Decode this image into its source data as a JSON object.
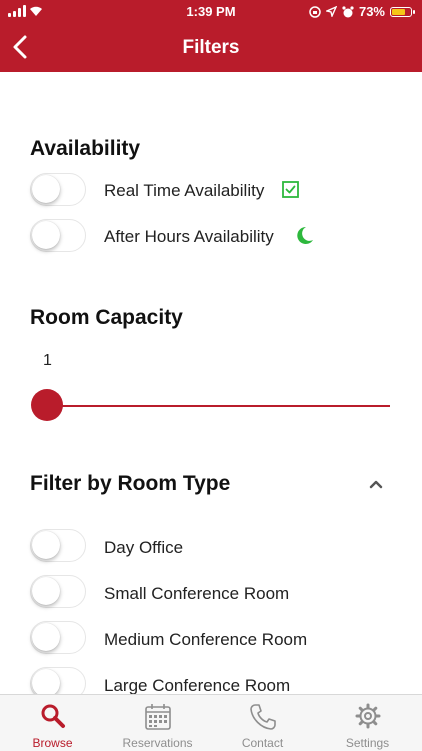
{
  "status_bar": {
    "time": "1:39 PM",
    "battery": "73%",
    "battery_fill": 0.73
  },
  "header": {
    "title": "Filters"
  },
  "availability": {
    "title": "Availability",
    "items": [
      {
        "label": "Real Time Availability",
        "icon": "checkbox-check-icon",
        "enabled": false
      },
      {
        "label": "After Hours Availability",
        "icon": "moon-icon",
        "enabled": false
      }
    ]
  },
  "room_capacity": {
    "title": "Room Capacity",
    "value": "1"
  },
  "room_type": {
    "title": "Filter by Room Type",
    "expanded": true,
    "items": [
      {
        "label": "Day Office",
        "enabled": false
      },
      {
        "label": "Small Conference Room",
        "enabled": false
      },
      {
        "label": "Medium Conference Room",
        "enabled": false
      },
      {
        "label": "Large Conference Room",
        "enabled": false
      }
    ]
  },
  "tabs": [
    {
      "label": "Browse",
      "icon": "search-icon",
      "active": true
    },
    {
      "label": "Reservations",
      "icon": "calendar-icon",
      "active": false
    },
    {
      "label": "Contact",
      "icon": "phone-icon",
      "active": false
    },
    {
      "label": "Settings",
      "icon": "gear-icon",
      "active": false
    }
  ],
  "colors": {
    "accent": "#B91C2B",
    "green": "#2DB83D",
    "battery": "#F5C518"
  }
}
